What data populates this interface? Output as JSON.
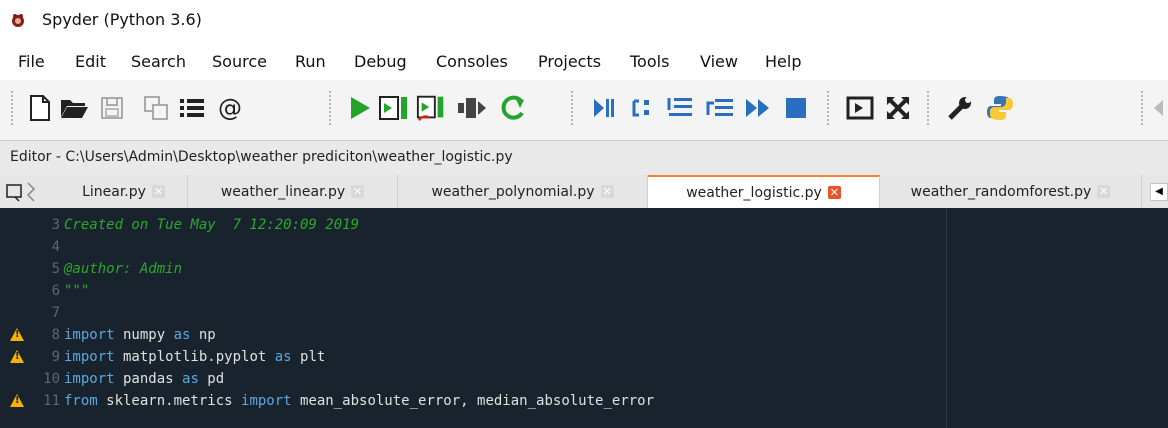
{
  "window": {
    "title": "Spyder (Python 3.6)"
  },
  "menu": [
    "File",
    "Edit",
    "Search",
    "Source",
    "Run",
    "Debug",
    "Consoles",
    "Projects",
    "Tools",
    "View",
    "Help"
  ],
  "toolbar": {
    "icons": [
      "new-file-icon",
      "open-folder-icon",
      "save-icon",
      "save-all-icon",
      "list-icon",
      "at-icon",
      "run-icon",
      "run-cell-icon",
      "run-cell-advance-icon",
      "run-selection-icon",
      "rerun-icon",
      "debug-icon",
      "step-icon",
      "step-into-icon",
      "step-return-icon",
      "continue-icon",
      "stop-icon",
      "maximize-pane-icon",
      "fullscreen-icon",
      "preferences-icon",
      "python-path-icon"
    ]
  },
  "editor": {
    "path": "Editor - C:\\Users\\Admin\\Desktop\\weather prediciton\\weather_logistic.py",
    "tabs": [
      {
        "label": "Linear.py",
        "active": false
      },
      {
        "label": "weather_linear.py",
        "active": false
      },
      {
        "label": "weather_polynomial.py",
        "active": false
      },
      {
        "label": "weather_logistic.py",
        "active": true
      },
      {
        "label": "weather_randomforest.py",
        "active": false
      }
    ],
    "lines": [
      {
        "num": "3",
        "warn": false,
        "tokens": [
          {
            "t": "Created on Tue May  7 12:20:09 2019",
            "c": "comment"
          }
        ]
      },
      {
        "num": "4",
        "warn": false,
        "tokens": []
      },
      {
        "num": "5",
        "warn": false,
        "tokens": [
          {
            "t": "@author: Admin",
            "c": "comment"
          }
        ]
      },
      {
        "num": "6",
        "warn": false,
        "tokens": [
          {
            "t": "\"\"\"",
            "c": "comment"
          }
        ]
      },
      {
        "num": "7",
        "warn": false,
        "tokens": []
      },
      {
        "num": "8",
        "warn": true,
        "tokens": [
          {
            "t": "import",
            "c": "kw"
          },
          {
            "t": " numpy ",
            "c": "plain"
          },
          {
            "t": "as",
            "c": "kw"
          },
          {
            "t": " np",
            "c": "plain"
          }
        ]
      },
      {
        "num": "9",
        "warn": true,
        "tokens": [
          {
            "t": "import",
            "c": "kw"
          },
          {
            "t": " matplotlib.pyplot ",
            "c": "plain"
          },
          {
            "t": "as",
            "c": "kw"
          },
          {
            "t": " plt",
            "c": "plain"
          }
        ]
      },
      {
        "num": "10",
        "warn": false,
        "tokens": [
          {
            "t": "import",
            "c": "kw"
          },
          {
            "t": " pandas ",
            "c": "plain"
          },
          {
            "t": "as",
            "c": "kw"
          },
          {
            "t": " pd",
            "c": "plain"
          }
        ]
      },
      {
        "num": "11",
        "warn": true,
        "tokens": [
          {
            "t": "from",
            "c": "kw"
          },
          {
            "t": " sklearn.metrics ",
            "c": "plain"
          },
          {
            "t": "import",
            "c": "kw"
          },
          {
            "t": " mean_absolute_error, median_absolute_error",
            "c": "plain"
          }
        ]
      }
    ]
  }
}
